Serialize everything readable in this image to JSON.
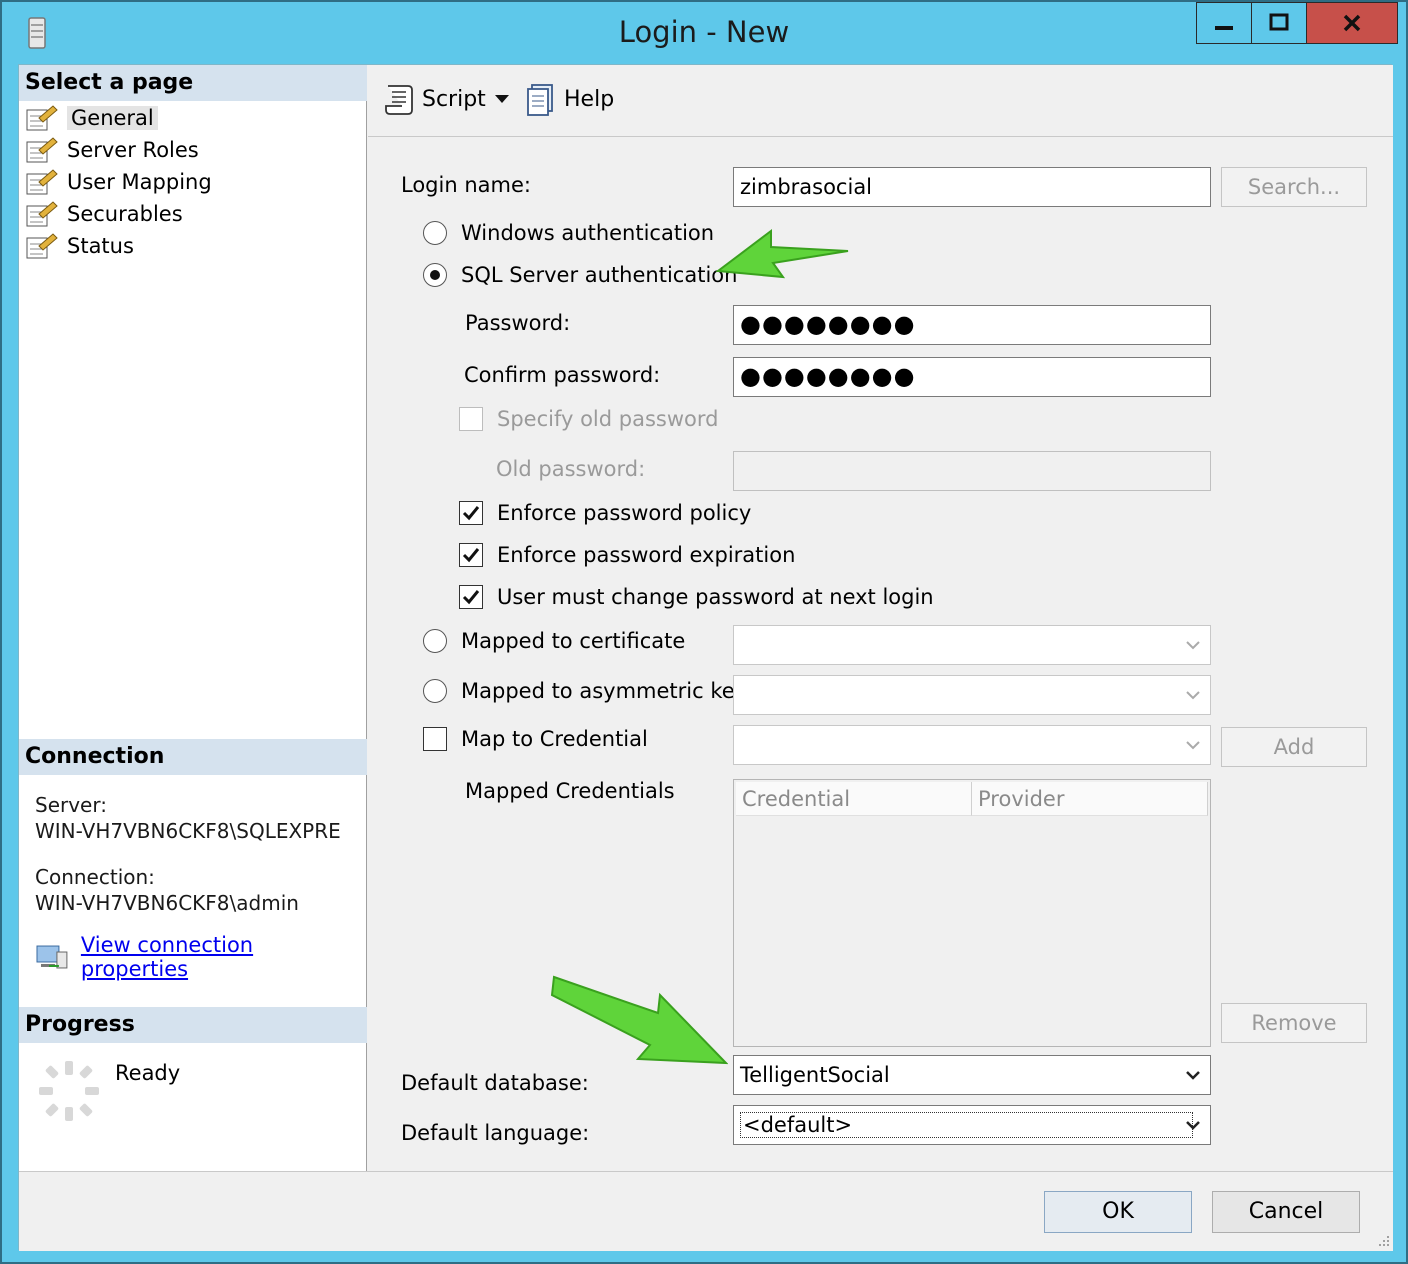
{
  "window": {
    "title": "Login - New"
  },
  "left": {
    "select_page_header": "Select a page",
    "pages": [
      "General",
      "Server Roles",
      "User Mapping",
      "Securables",
      "Status"
    ],
    "connection_header": "Connection",
    "server_label": "Server:",
    "server_value": "WIN-VH7VBN6CKF8\\SQLEXPRE",
    "connection_label": "Connection:",
    "connection_value": "WIN-VH7VBN6CKF8\\admin",
    "view_link": "View connection properties",
    "progress_header": "Progress",
    "progress_status": "Ready"
  },
  "toolbar": {
    "script_label": "Script",
    "help_label": "Help"
  },
  "form": {
    "login_name_label": "Login name:",
    "login_name_value": "zimbrasocial",
    "search_button": "Search...",
    "windows_auth": "Windows authentication",
    "sql_auth": "SQL Server authentication",
    "password_label": "Password:",
    "password_value": "●●●●●●●●",
    "confirm_label": "Confirm password:",
    "confirm_value": "●●●●●●●●",
    "specify_old": "Specify old password",
    "old_password_label": "Old password:",
    "enforce_policy": "Enforce password policy",
    "enforce_expiration": "Enforce password expiration",
    "must_change": "User must change password at next login",
    "mapped_cert": "Mapped to certificate",
    "mapped_asym": "Mapped to asymmetric key",
    "map_credential": "Map to Credential",
    "add_button": "Add",
    "mapped_credentials_label": "Mapped Credentials",
    "grid_columns": [
      "Credential",
      "Provider"
    ],
    "remove_button": "Remove",
    "default_db_label": "Default database:",
    "default_db_value": "TelligentSocial",
    "default_lang_label": "Default language:",
    "default_lang_value": "<default>"
  },
  "footer": {
    "ok": "OK",
    "cancel": "Cancel"
  },
  "colors": {
    "titlebar": "#5ec8ea",
    "close": "#c7504a",
    "section_header": "#d5e2ee",
    "arrow": "#5fd43a"
  }
}
